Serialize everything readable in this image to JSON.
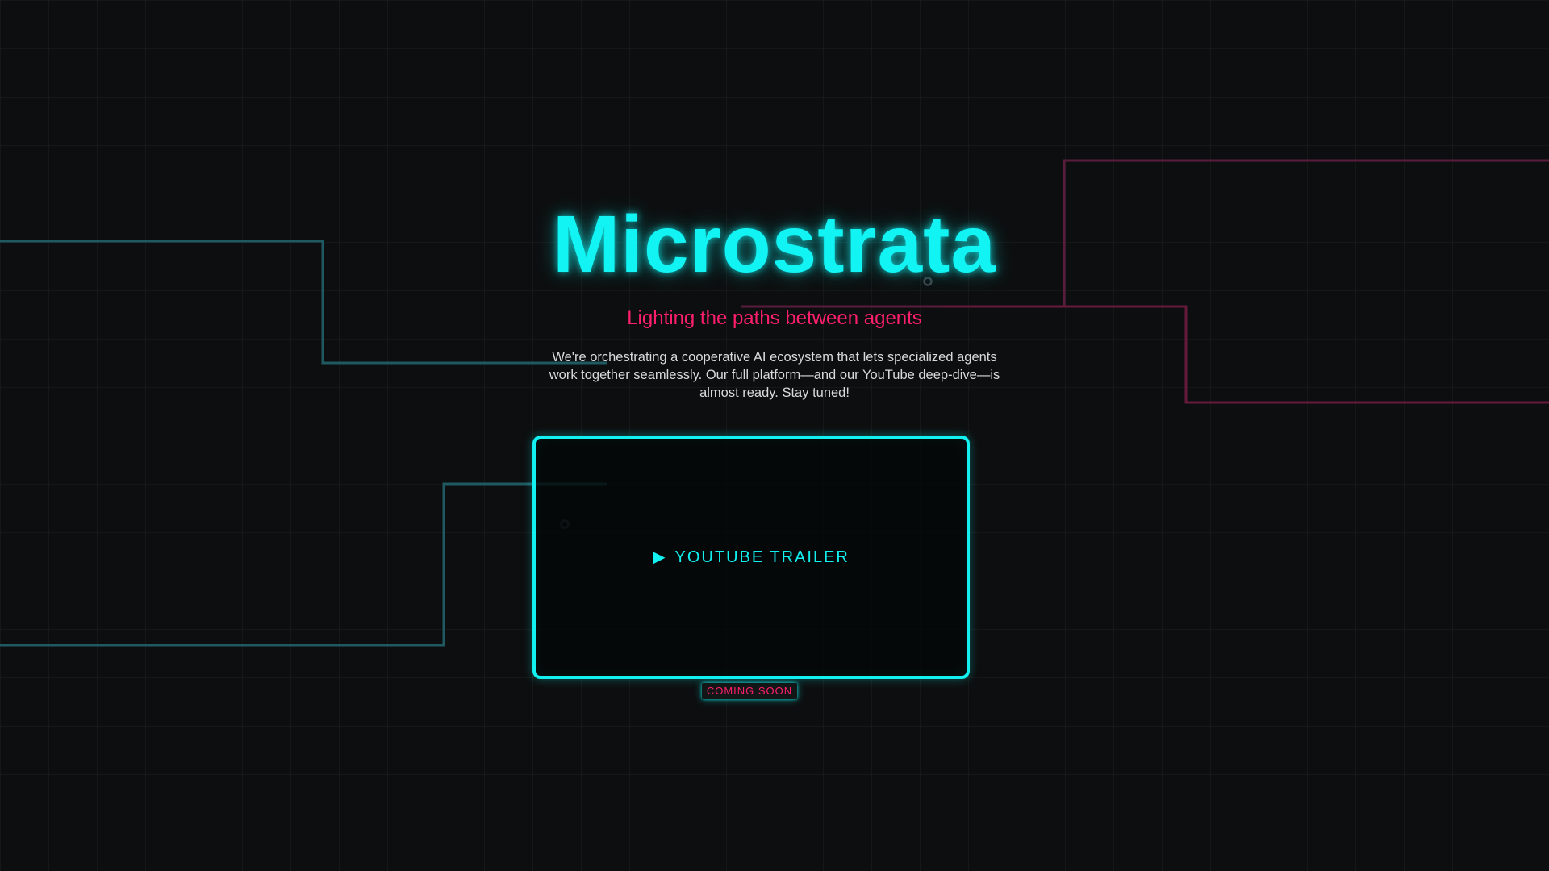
{
  "hero": {
    "title": "Microstrata",
    "tagline": "Lighting the paths between agents",
    "description": "We're orchestrating a cooperative AI ecosystem that lets specialized agents work together seamlessly. Our full platform—and our YouTube deep-dive—is almost ready. Stay tuned!"
  },
  "video": {
    "icon": "play-icon",
    "icon_glyph": "▶",
    "label": "YOUTUBE TRAILER",
    "badge": "COMING SOON"
  },
  "colors": {
    "accent_cyan": "#12f0f0",
    "accent_pink": "#ff1f6b",
    "background": "#0d0e0f",
    "body_text": "#d8dadc"
  }
}
